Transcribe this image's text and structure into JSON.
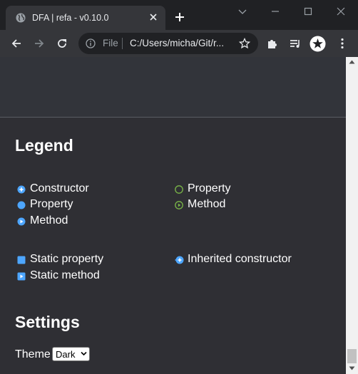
{
  "browser": {
    "tab": {
      "title": "DFA | refa - v0.10.0"
    },
    "address": {
      "scheme_label": "File",
      "url": "C:/Users/micha/Git/r..."
    }
  },
  "page": {
    "legend": {
      "heading": "Legend",
      "items": [
        {
          "label": "Constructor",
          "icon": "constructor-icon",
          "color": "#4da6ff"
        },
        {
          "label": "Property",
          "icon": "property-icon",
          "color": "#4da6ff"
        },
        {
          "label": "Method",
          "icon": "method-icon",
          "color": "#4da6ff"
        },
        {
          "label": "Property",
          "icon": "property-outline-icon",
          "color": "#7ab648"
        },
        {
          "label": "Method",
          "icon": "method-outline-icon",
          "color": "#7ab648"
        },
        {
          "label": "Static property",
          "icon": "static-property-icon",
          "color": "#4da6ff"
        },
        {
          "label": "Static method",
          "icon": "static-method-icon",
          "color": "#4da6ff"
        },
        {
          "label": "Inherited constructor",
          "icon": "inherited-constructor-icon",
          "color": "#4da6ff"
        }
      ]
    },
    "settings": {
      "heading": "Settings",
      "theme_label": "Theme",
      "theme_value": "Dark"
    }
  }
}
